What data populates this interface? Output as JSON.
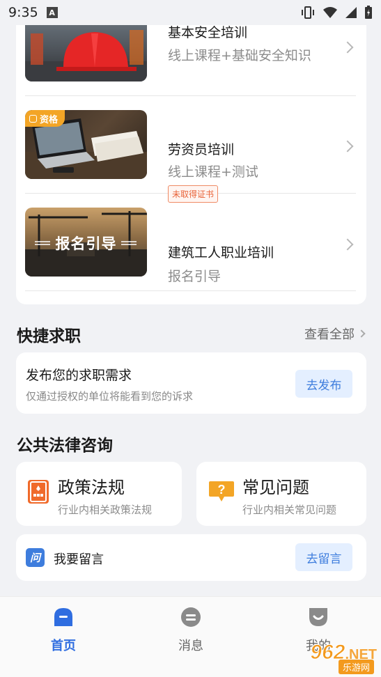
{
  "status_bar": {
    "time": "9:35",
    "notification_icon_letter": "A"
  },
  "courses": [
    {
      "title": "基本安全培训",
      "subtitle": "线上课程+基础安全知识"
    },
    {
      "tag": "资格",
      "title": "劳资员培训",
      "subtitle": "线上课程+测试",
      "badge": "未取得证书"
    },
    {
      "title": "建筑工人职业培训",
      "subtitle": "报名引导",
      "thumb_text": "报名引导"
    }
  ],
  "job_section": {
    "title": "快捷求职",
    "see_all": "查看全部",
    "card_title": "发布您的求职需求",
    "card_desc": "仅通过授权的单位将能看到您的诉求",
    "button": "去发布"
  },
  "legal_section": {
    "title": "公共法律咨询",
    "policy": {
      "title": "政策法规",
      "desc": "行业内相关政策法规",
      "icon": "policy-book-icon"
    },
    "faq": {
      "title": "常见问题",
      "desc": "行业内相关常见问题",
      "icon": "question-bubble-icon"
    },
    "message": {
      "label": "我要留言",
      "button": "去留言",
      "icon_char": "问"
    }
  },
  "nav": {
    "home": "首页",
    "messages": "消息",
    "mine": "我的"
  },
  "watermark": {
    "number": "962",
    "suffix": ".NET",
    "sub": "乐游网"
  },
  "colors": {
    "accent": "#2f6de0",
    "tag": "#f3a526",
    "badge": "#e8643a"
  }
}
